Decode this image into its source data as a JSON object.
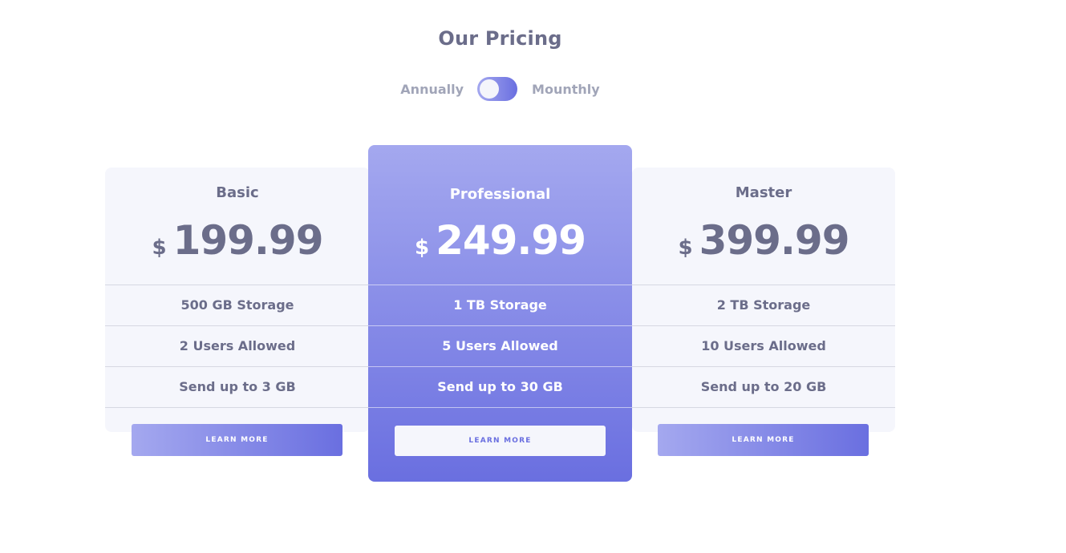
{
  "header": {
    "title": "Our Pricing"
  },
  "billing_toggle": {
    "left_label": "Annually",
    "right_label": "Mounthly"
  },
  "plans": [
    {
      "name": "Basic",
      "currency": "$",
      "price": "199.99",
      "features": [
        "500 GB Storage",
        "2 Users Allowed",
        "Send up to 3 GB"
      ],
      "button_label": "LEARN MORE"
    },
    {
      "name": "Professional",
      "currency": "$",
      "price": "249.99",
      "features": [
        "1 TB Storage",
        "5 Users Allowed",
        "Send up to 30 GB"
      ],
      "button_label": "LEARN MORE"
    },
    {
      "name": "Master",
      "currency": "$",
      "price": "399.99",
      "features": [
        "2 TB Storage",
        "10 Users Allowed",
        "Send up to 20 GB"
      ],
      "button_label": "LEARN MORE"
    }
  ],
  "colors": {
    "accent_light": "#a4a8ef",
    "accent_dark": "#6a6fe0",
    "text": "#6b6d8a",
    "muted": "#a1a5b8",
    "card_bg": "#f5f6fc"
  }
}
